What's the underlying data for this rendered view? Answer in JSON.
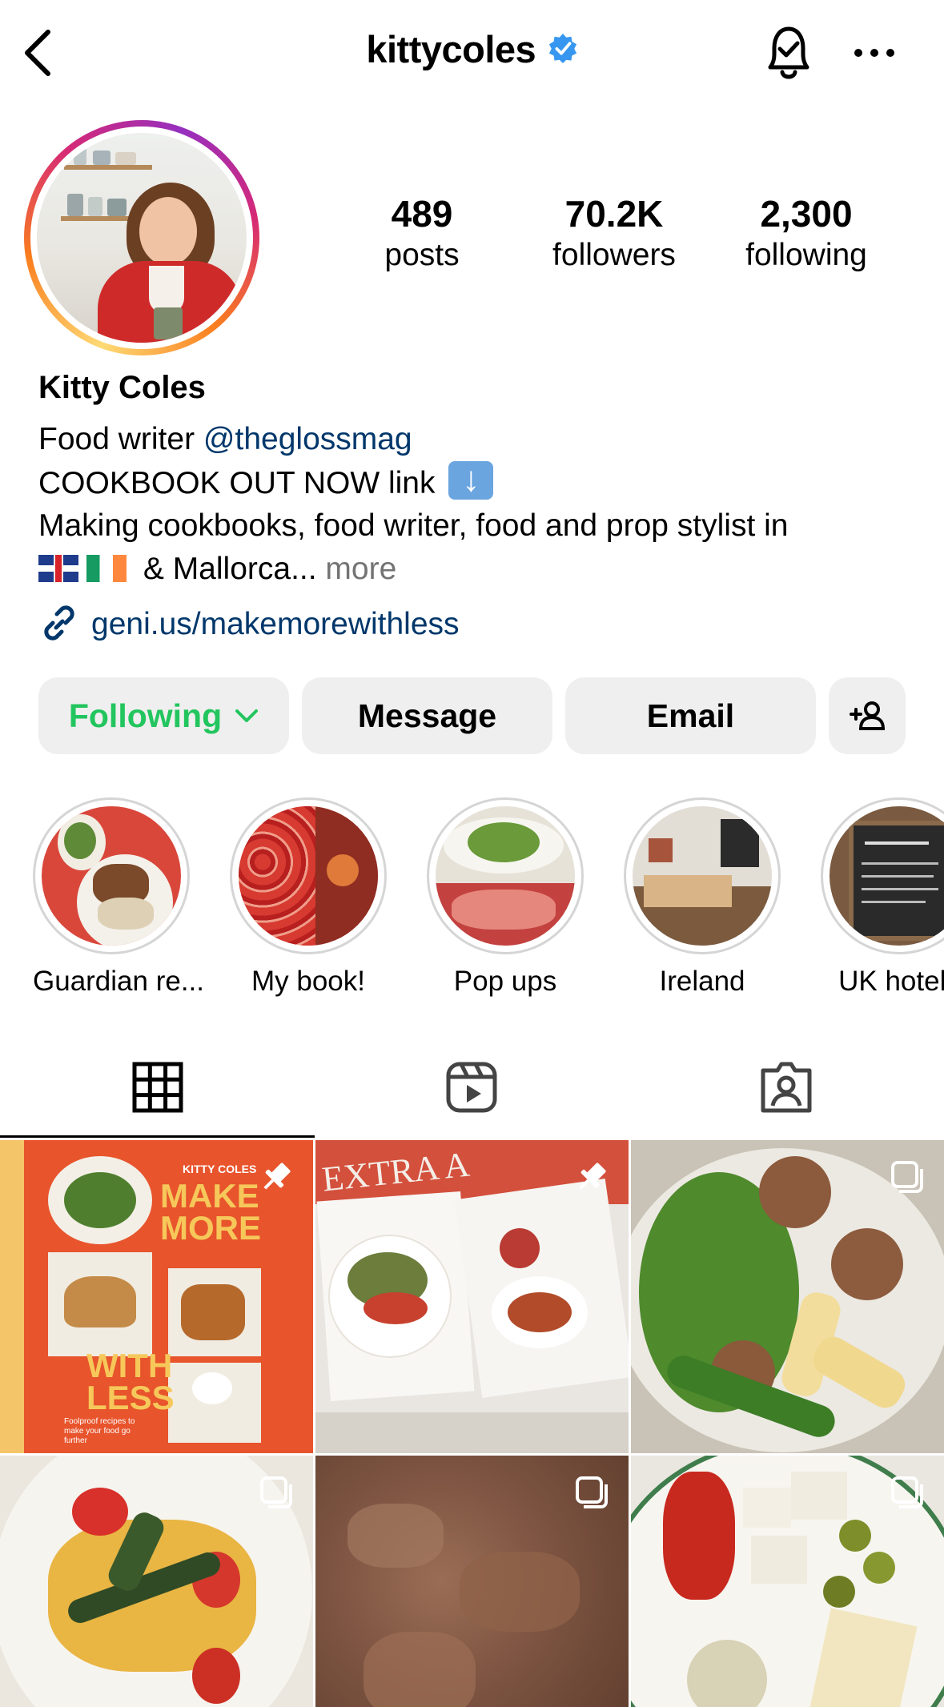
{
  "header": {
    "username": "kittycoles",
    "verified": true,
    "icons": [
      "back-arrow-icon",
      "verified-badge-icon",
      "notification-bell-icon",
      "more-options-icon"
    ]
  },
  "profile": {
    "stats": [
      {
        "value": "489",
        "label": "posts"
      },
      {
        "value": "70.2K",
        "label": "followers"
      },
      {
        "value": "2,300",
        "label": "following"
      }
    ],
    "display_name": "Kitty Coles",
    "bio": {
      "line1_prefix": "Food writer ",
      "line1_mention": "@theglossmag",
      "line2": "COOKBOOK OUT NOW link",
      "line3": "Making cookbooks, food writer, food and prop stylist in",
      "line4": "& Mallorca...",
      "line4_more": " more",
      "flags": [
        "uk-flag-icon",
        "ireland-flag-icon"
      ]
    },
    "link": "geni.us/makemorewithless"
  },
  "actions": {
    "following_label": "Following",
    "message_label": "Message",
    "email_label": "Email"
  },
  "highlights": [
    {
      "label": "Guardian re..."
    },
    {
      "label": "My book!"
    },
    {
      "label": "Pop ups"
    },
    {
      "label": "Ireland"
    },
    {
      "label": "UK hotels"
    }
  ],
  "tabs": [
    "grid-tab",
    "reels-tab",
    "tagged-tab"
  ],
  "posts": {
    "cover": {
      "author": "KITTY COLES",
      "title_top1": "MAKE",
      "title_top2": "MORE",
      "title_bottom1": "WITH",
      "title_bottom2": "LESS",
      "tagline": "Foolproof recipes to make your food go further"
    },
    "magazine_word": "EXTRA A"
  },
  "colors": {
    "following_green": "#22c55e",
    "link_blue": "#00376b",
    "verified_blue": "#3797f0",
    "button_gray": "#efefef",
    "cover_orange": "#e8542c"
  }
}
